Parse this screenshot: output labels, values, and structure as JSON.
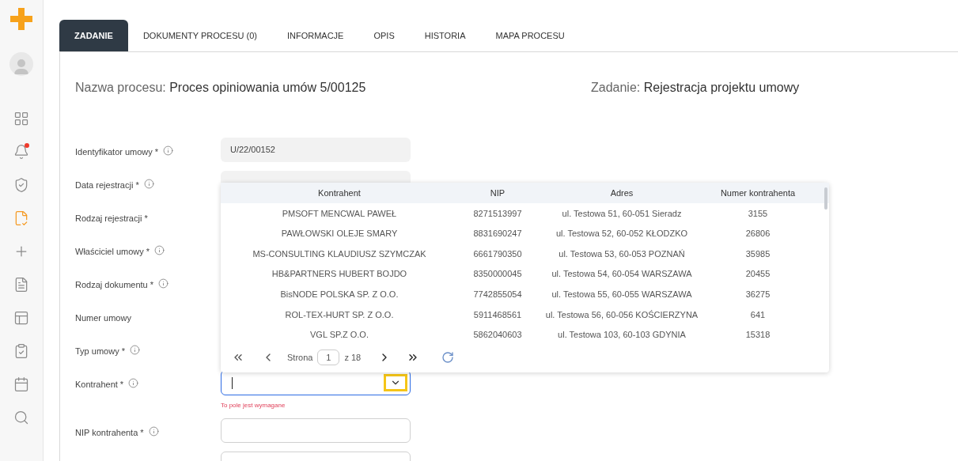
{
  "tabs": [
    {
      "label": "ZADANIE",
      "selected": true
    },
    {
      "label": "DOKUMENTY PROCESU (0)",
      "selected": false
    },
    {
      "label": "INFORMACJE",
      "selected": false
    },
    {
      "label": "OPIS",
      "selected": false
    },
    {
      "label": "HISTORIA",
      "selected": false
    },
    {
      "label": "MAPA PROCESU",
      "selected": false
    }
  ],
  "sidebar": {
    "items": [
      {
        "selected": false,
        "badge": false
      },
      {
        "selected": false,
        "badge": true
      },
      {
        "selected": false,
        "badge": false
      },
      {
        "selected": true,
        "badge": false
      },
      {
        "selected": false,
        "badge": false
      },
      {
        "selected": false,
        "badge": false
      },
      {
        "selected": false,
        "badge": false
      },
      {
        "selected": false,
        "badge": false
      },
      {
        "selected": false,
        "badge": false
      },
      {
        "selected": false,
        "badge": false
      }
    ]
  },
  "header": {
    "process_label": "Nazwa procesu:",
    "process_value": "Proces opiniowania umów 5/00125",
    "task_label": "Zadanie:",
    "task_value": "Rejestracja projektu umowy"
  },
  "fields": [
    {
      "label": "Identyfikator umowy *",
      "info": true,
      "kind": "readonly",
      "value": "U/22/00152"
    },
    {
      "label": "Data rejestracji *",
      "info": true,
      "kind": "readonly"
    },
    {
      "label": "Rodzaj rejestracji *",
      "info": false,
      "kind": "hidden"
    },
    {
      "label": "Właściciel umowy *",
      "info": true,
      "kind": "hidden"
    },
    {
      "label": "Rodzaj dokumentu *",
      "info": true,
      "kind": "hidden"
    },
    {
      "label": "Numer umowy",
      "info": false,
      "kind": "hidden"
    },
    {
      "label": "Typ umowy *",
      "info": true,
      "kind": "hidden"
    },
    {
      "label": "Kontrahent *",
      "info": true,
      "kind": "combo",
      "error": "To pole jest wymagane"
    },
    {
      "label": "NIP kontrahenta *",
      "info": true,
      "kind": "text"
    },
    {
      "info": false,
      "kind": "text"
    }
  ],
  "dropdown": {
    "columns": [
      "Kontrahent",
      "NIP",
      "Adres",
      "Numer kontrahenta"
    ],
    "rows": [
      [
        "PMSOFT MENCWAL PAWEŁ",
        "8271513997",
        "ul. Testowa 51, 60-051 Sieradz",
        "3155"
      ],
      [
        "PAWŁOWSKI OLEJE SMARY",
        "8831690247",
        "ul. Testowa 52, 60-052 KŁODZKO",
        "26806"
      ],
      [
        "MS-CONSULTING KLAUDIUSZ SZYMCZAK",
        "6661790350",
        "ul. Testowa 53, 60-053 POZNAŃ",
        "35985"
      ],
      [
        "HB&PARTNERS HUBERT BOJDO",
        "8350000045",
        "ul. Testowa 54, 60-054 WARSZAWA",
        "20455"
      ],
      [
        "BisNODE POLSKA SP. Z O.O.",
        "7742855054",
        "ul. Testowa 55, 60-055 WARSZAWA",
        "36275"
      ],
      [
        "ROL-TEX-HURT SP. Z O.O.",
        "5911468561",
        "ul. Testowa 56, 60-056 KOŚCIERZYNA",
        "641"
      ],
      [
        "VGL SP.Z O.O.",
        "5862040603",
        "ul. Testowa 103, 60-103 GDYNIA",
        "15318"
      ]
    ],
    "pager": {
      "label": "Strona",
      "page": "1",
      "of": "z 18"
    }
  }
}
